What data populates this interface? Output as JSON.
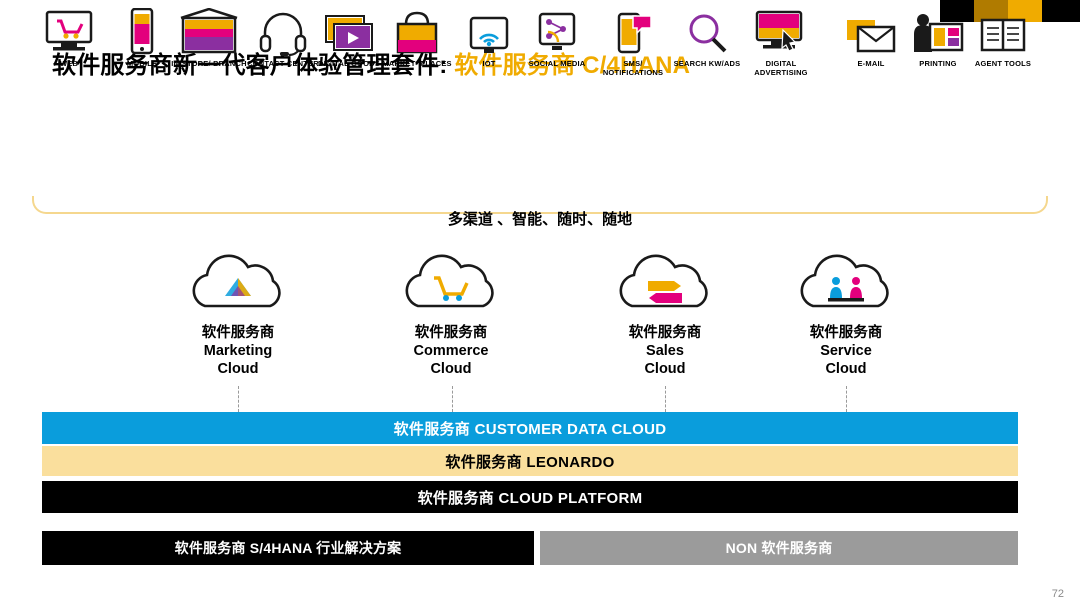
{
  "title": {
    "main": "软件服务商新一代客户体验管理套件: ",
    "accent": "软件服务商 C/4HANA"
  },
  "colors": {
    "accent_yellow": "#f0ab00",
    "band_blue": "#0a9ddc",
    "band_cream": "#fadf9d",
    "band_black": "#000000",
    "band_grey": "#9b9b9b",
    "underline": "#f5d78e"
  },
  "channels": [
    {
      "icon": "desktop-cart-icon",
      "label": "WEB"
    },
    {
      "icon": "mobile-phone-icon",
      "label": "MOBILE"
    },
    {
      "icon": "storefront-icon",
      "label": "IN-STORE/\nBRANCH"
    },
    {
      "icon": "headset-icon",
      "label": "CONTACT\nCENTER"
    },
    {
      "icon": "media-stack-icon",
      "label": "DIGITAL\nGOODS"
    },
    {
      "icon": "shopping-bag-icon",
      "label": "MARKET-\nPLACES"
    },
    {
      "icon": "wifi-signal-icon",
      "label": "IOT"
    },
    {
      "icon": "social-share-icon",
      "label": "SOCIAL\nMEDIA"
    },
    {
      "icon": "sms-bubble-icon",
      "label": "SMS/\nNOTIFICATIONS"
    },
    {
      "icon": "magnifier-icon",
      "label": "SEARCH\nKW/ADS"
    },
    {
      "icon": "monitor-cursor-icon",
      "label": "DIGITAL\nADVERTISING"
    },
    {
      "icon": "envelope-icon",
      "label": "E-MAIL"
    },
    {
      "icon": "printer-person-icon",
      "label": "PRINTING"
    },
    {
      "icon": "open-book-icon",
      "label": "AGENT\nTOOLS"
    }
  ],
  "tagline": "多渠道 、智能、随时、随地",
  "clouds": [
    {
      "art": "marketing-cloud-icon",
      "caption": "软件服务商\nMarketing\nCloud"
    },
    {
      "art": "commerce-cloud-icon",
      "caption": "软件服务商\nCommerce\nCloud"
    },
    {
      "art": "sales-cloud-icon",
      "caption": "软件服务商\nSales\nCloud"
    },
    {
      "art": "service-cloud-icon",
      "caption": "软件服务商\nService\nCloud"
    }
  ],
  "bands": {
    "customer_data_cloud": "软件服务商 CUSTOMER DATA CLOUD",
    "leonardo": "软件服务商 LEONARDO",
    "cloud_platform": "软件服务商 CLOUD PLATFORM",
    "bottom_left": "软件服务商 S/4HANA 行业解决方案",
    "bottom_right": "NON 软件服务商"
  },
  "page_number": "72"
}
